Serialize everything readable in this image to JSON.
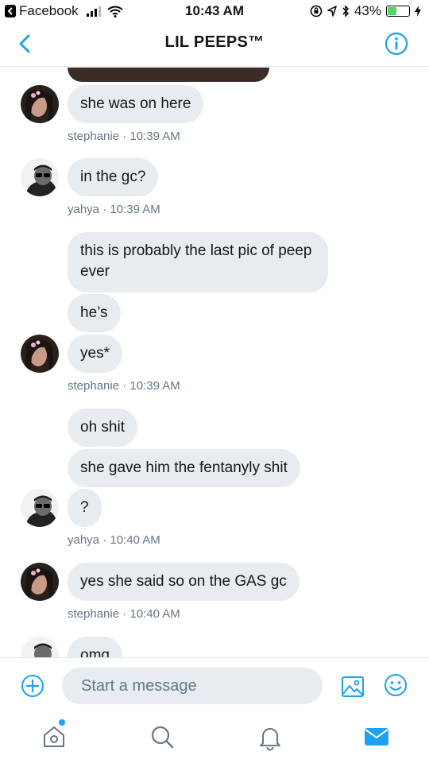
{
  "status_bar": {
    "back_app": "Facebook",
    "time": "10:43 AM",
    "battery": "43%",
    "battery_level": 0.43
  },
  "header": {
    "title": "LIL PEEPS™"
  },
  "messages": [
    {
      "text": "she was on here"
    },
    {
      "text": "in the gc?"
    },
    {
      "text": "this is probably the last pic of peep ever"
    },
    {
      "text": "he’s"
    },
    {
      "text": "yes*"
    },
    {
      "text": "oh shit"
    },
    {
      "text": "she gave him the fentanyly shit"
    },
    {
      "text": "?"
    },
    {
      "text": "yes she said so on the GAS gc"
    },
    {
      "text": "omg"
    }
  ],
  "meta": [
    {
      "sender": "stephanie",
      "sep": "·",
      "time": "10:39 AM"
    },
    {
      "sender": "yahya",
      "sep": "·",
      "time": "10:39 AM"
    },
    {
      "sender": "stephanie",
      "sep": "·",
      "time": "10:39 AM"
    },
    {
      "sender": "yahya",
      "sep": "·",
      "time": "10:40 AM"
    },
    {
      "sender": "stephanie",
      "sep": "·",
      "time": "10:40 AM"
    }
  ],
  "compose": {
    "placeholder": "Start a message"
  },
  "colors": {
    "accent": "#1da1f2",
    "bubble": "#e6ecf0",
    "meta_text": "#657786"
  },
  "icons": {
    "header": [
      "chevron-left-icon",
      "info-icon"
    ],
    "compose": [
      "add-icon",
      "image-icon",
      "emoji-icon"
    ],
    "tabs": [
      "home-icon",
      "search-icon",
      "notifications-icon",
      "messages-icon"
    ]
  }
}
